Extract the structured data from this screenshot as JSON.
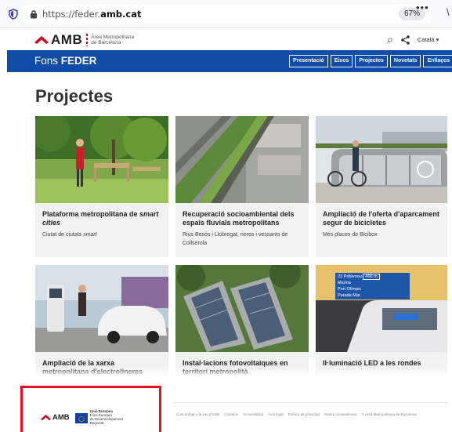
{
  "browser": {
    "url_prefix": "https://feder.",
    "url_domain": "amb.cat",
    "zoom": "67%",
    "menu_glyph": "•••",
    "edge_glyph": "\\"
  },
  "header": {
    "logo_text": "AMB",
    "logo_sub_1": "Àrea Metropolitana",
    "logo_sub_2": "de Barcelona",
    "search_glyph": "⌕",
    "share_glyph": "<",
    "language": "Català ▾"
  },
  "nav": {
    "site_prefix": "Fons ",
    "site_name": "FEDER",
    "items": [
      "Presentació",
      "Eixos",
      "Projectes",
      "Novetats",
      "Enllaços"
    ]
  },
  "page": {
    "title": "Projectes"
  },
  "cards": [
    {
      "title_a": "Plataforma metropolitana de ",
      "title_b": "smart cities",
      "desc_a": "Ciutat de ciutats ",
      "desc_b": "smart"
    },
    {
      "title": "Recuperació socioambiental dels espais fluvials metropolitans",
      "desc": "Rius Besòs i Llobregat, rieres i vessants de Collserola"
    },
    {
      "title": "Ampliació de l'oferta d'aparcament segur de bicicletes",
      "desc": "Més places de Bicibox"
    },
    {
      "title": "Ampliació de la xarxa metropolitana d'electrolineres",
      "desc": ""
    },
    {
      "title": "Instal·lacions fotovoltaiques en territori metropolità",
      "desc": ""
    },
    {
      "title": "Il·luminació LED a les rondes",
      "desc": ""
    }
  ],
  "sign": {
    "line1": "23 Poblenou",
    "dist": "400 m",
    "line2": "Marina",
    "line3": "Port Olímpic",
    "line4": "Parada  Mar"
  },
  "footer": {
    "logo_text": "AMB",
    "eu_line1": "Unió Europea",
    "eu_line2": "Fons Europeu",
    "eu_line3": "de Desenvolupament Regional",
    "links": [
      "Com arribar a la seu d'AMB",
      "Contacte",
      "Accessibilitat",
      "Avís legal",
      "Política de privacitat",
      "Gestor consentiment",
      "© Àrea Metropolitana de Barcelona"
    ]
  }
}
